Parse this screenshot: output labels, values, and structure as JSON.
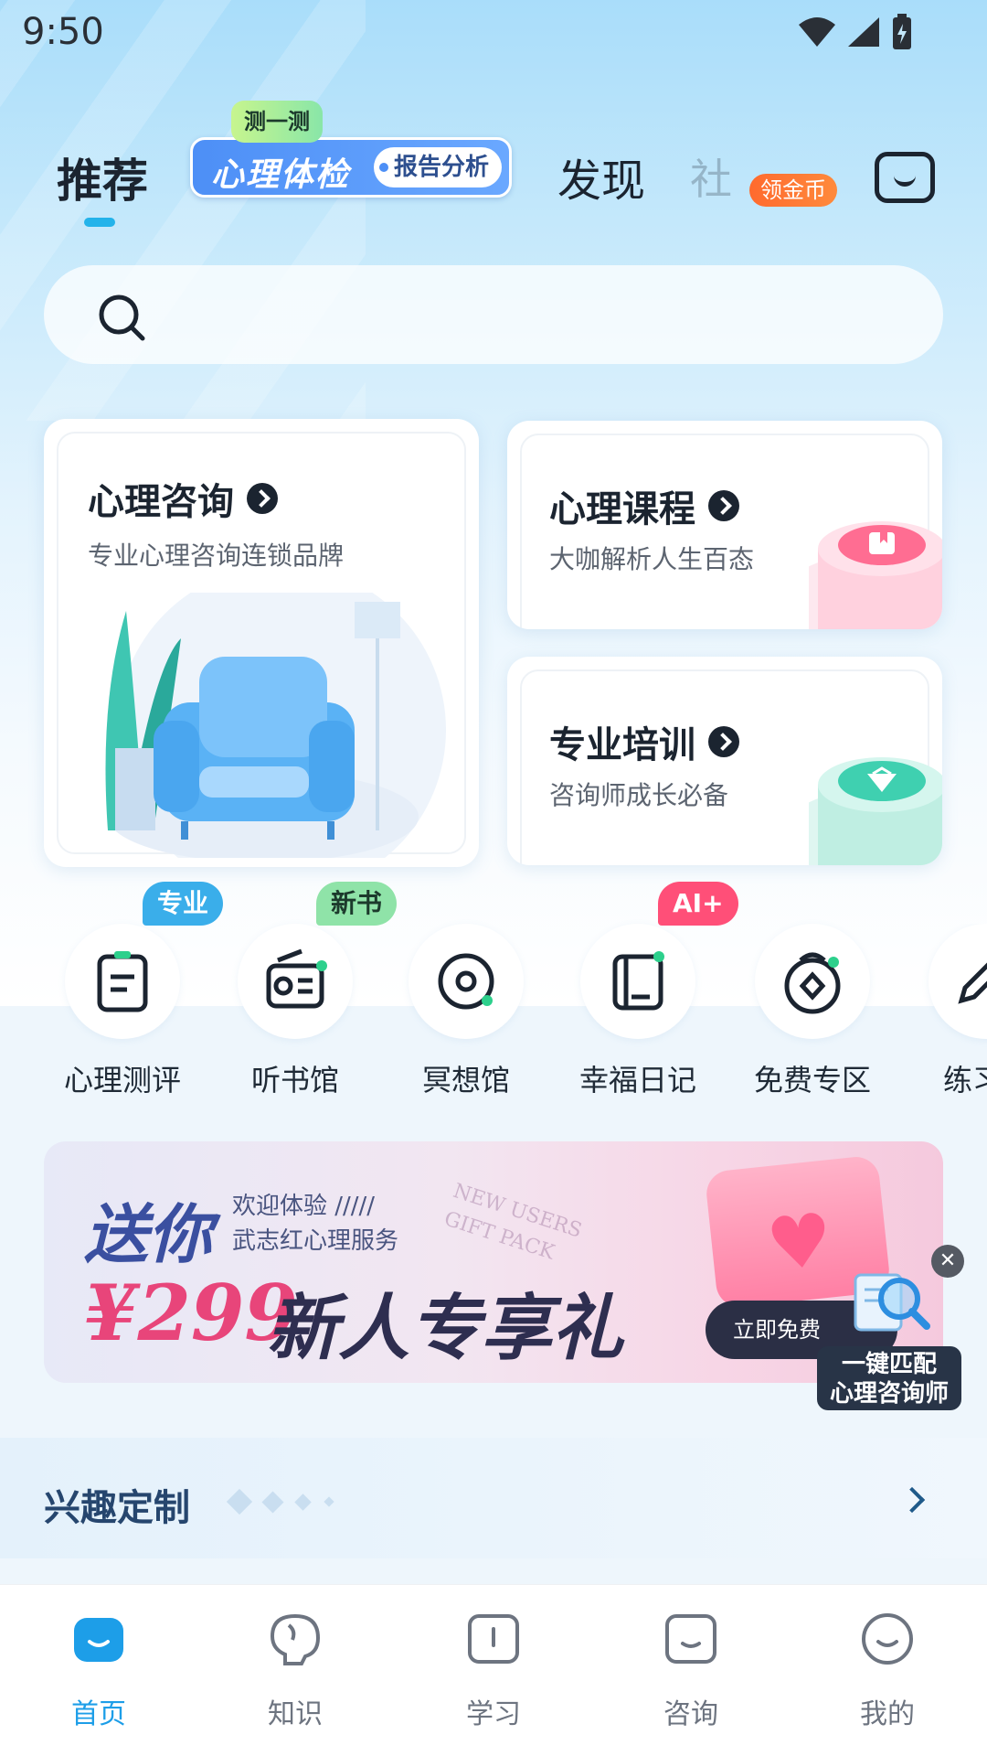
{
  "status_bar": {
    "time": "9:50"
  },
  "top_tabs": {
    "recommend": "推荐",
    "promo_tag": "测一测",
    "promo_main": "心理体检",
    "promo_pill": "报告分析",
    "discover": "发现",
    "faded_tab": "社",
    "coin_badge": "领金币"
  },
  "search": {
    "placeholder": ""
  },
  "service_cards": {
    "counseling": {
      "title": "心理咨询",
      "subtitle": "专业心理咨询连锁品牌"
    },
    "course": {
      "title": "心理课程",
      "subtitle": "大咖解析人生百态"
    },
    "training": {
      "title": "专业培训",
      "subtitle": "咨询师成长必备"
    }
  },
  "quick_entries": [
    {
      "label": "心理测评",
      "badge": "专业",
      "icon": "assessment-icon"
    },
    {
      "label": "听书馆",
      "badge": "新书",
      "icon": "radio-icon"
    },
    {
      "label": "冥想馆",
      "badge": "",
      "icon": "meditation-icon"
    },
    {
      "label": "幸福日记",
      "badge": "AI+",
      "icon": "diary-icon"
    },
    {
      "label": "免费专区",
      "badge": "",
      "icon": "free-zone-icon"
    },
    {
      "label": "练习",
      "badge": "",
      "icon": "practice-icon"
    }
  ],
  "banner": {
    "headline": "送你",
    "welcome_line1": "欢迎体验 /////",
    "welcome_line2": "武志红心理服务",
    "amount": "¥299",
    "gift_text": "新人专享礼",
    "english_line1": "NEW USERS",
    "english_line2": "GIFT PACK",
    "claim_button": "立即免费"
  },
  "floating_match": {
    "line1": "一键匹配",
    "line2": "心理咨询师"
  },
  "interest_section": {
    "title": "兴趣定制"
  },
  "bottom_nav": [
    {
      "label": "首页",
      "icon": "home-icon",
      "active": true
    },
    {
      "label": "知识",
      "icon": "knowledge-icon",
      "active": false
    },
    {
      "label": "学习",
      "icon": "study-icon",
      "active": false
    },
    {
      "label": "咨询",
      "icon": "consult-icon",
      "active": false
    },
    {
      "label": "我的",
      "icon": "profile-icon",
      "active": false
    }
  ],
  "colors": {
    "accent": "#1d9ee8",
    "coin_badge": "#ff6a2e",
    "ai_badge": "#ff4f78",
    "pro_badge": "#3aaeea",
    "new_badge": "#8fe3a8"
  }
}
